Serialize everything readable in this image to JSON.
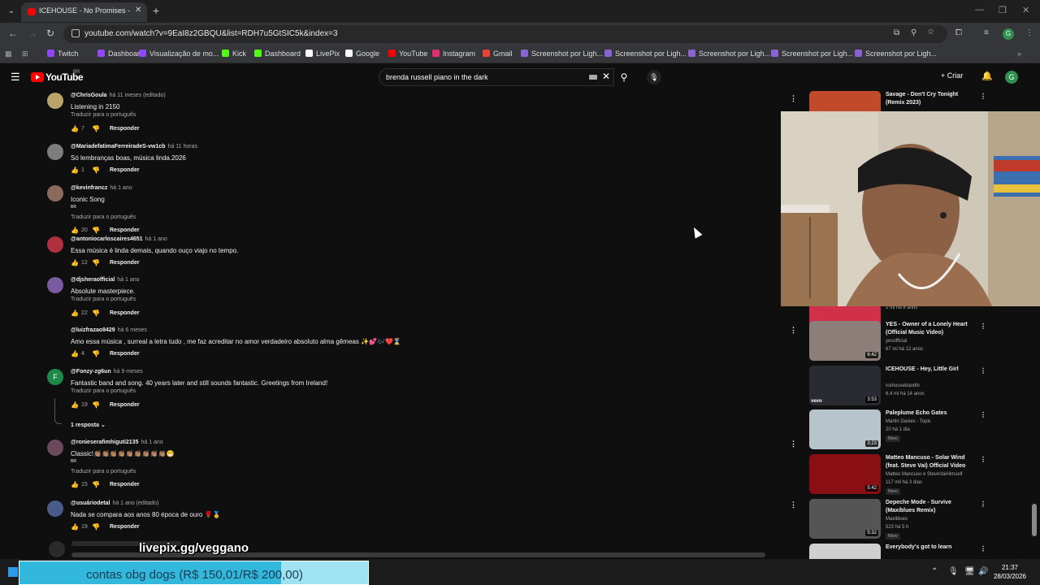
{
  "browser": {
    "tab_title": "ICEHOUSE - No Promises - Offi",
    "url": "youtube.com/watch?v=9EaI8z2GBQU&list=RDH7u5GtSIC5k&index=3",
    "bookmarks": [
      {
        "label": "Twitch",
        "color": "#9146ff"
      },
      {
        "label": "Dashboard",
        "color": "#9146ff"
      },
      {
        "label": "Visualização de mo...",
        "color": "#9146ff"
      },
      {
        "label": "Kick",
        "color": "#53fc18"
      },
      {
        "label": "Dashboard",
        "color": "#53fc18"
      },
      {
        "label": "LivePix",
        "color": "#ffffff"
      },
      {
        "label": "Google",
        "color": "#ffffff"
      },
      {
        "label": "YouTube",
        "color": "#ff0000"
      },
      {
        "label": "Instagram",
        "color": "#e1306c"
      },
      {
        "label": "Gmail",
        "color": "#ea4335"
      },
      {
        "label": "Screenshot por Ligh...",
        "color": "#8a63d2"
      },
      {
        "label": "Screenshot por Ligh...",
        "color": "#8a63d2"
      },
      {
        "label": "Screenshot por Ligh...",
        "color": "#8a63d2"
      },
      {
        "label": "Screenshot por Ligh...",
        "color": "#8a63d2"
      },
      {
        "label": "Screenshot por Ligh...",
        "color": "#8a63d2"
      }
    ],
    "profile_initial": "G"
  },
  "youtube": {
    "logo_text": "YouTube",
    "logo_region": "BR",
    "search_query": "brenda russell piano in the dark",
    "create_label": "Criar",
    "avatar_initial": "G"
  },
  "comments": [
    {
      "author": "@ChrisGoula",
      "time": "há 11 meses (editado)",
      "text": "Listening in 2150",
      "translate": "Traduzir para o português",
      "likes": "7",
      "reply": "Responder",
      "avatar_color": "#b9a46a"
    },
    {
      "author": "@MariadefatimaFerreiradeS-vw1cb",
      "time": "há 11 horas",
      "text": "Só lembranças boas, música linda.2026",
      "translate": "",
      "likes": "1",
      "reply": "Responder",
      "avatar_color": "#7d7d7d"
    },
    {
      "author": "@kevinfrancz",
      "time": "há 1 ano",
      "text": "Iconic Song",
      "flag": "BR",
      "translate": "Traduzir para o português",
      "likes": "20",
      "reply": "Responder",
      "avatar_color": "#8a6a5a"
    },
    {
      "author": "@antoniocarloscaires4651",
      "time": "há 1 ano",
      "text": "Essa música é linda demais, quando ouço viajo no tempo.",
      "translate": "",
      "likes": "12",
      "reply": "Responder",
      "avatar_color": "#b03040"
    },
    {
      "author": "@djsheraofficial",
      "time": "há 1 ano",
      "text": "Absolute masterpiece.",
      "translate": "Traduzir para o português",
      "likes": "22",
      "reply": "Responder",
      "avatar_color": "#7a5aa0"
    },
    {
      "author": "@luizfrazao9429",
      "time": "há 6 meses",
      "text": "Amo essa música , surreal a letra tudo , me faz acreditar no amor verdadeiro absoluto alma gêmeas ✨💕🎶❤️⌛",
      "translate": "",
      "likes": "4",
      "reply": "Responder",
      "avatar_color": "#0f0f0f"
    },
    {
      "author": "@Fonzy-zg6un",
      "time": "há 9 meses",
      "text": "Fantastic band and song. 40 years later and still sounds fantastic.  Greetings from Ireland!",
      "translate": "Traduzir para o português",
      "likes": "19",
      "reply": "Responder",
      "avatar_color": "#1e8a4a",
      "initial": "F"
    },
    {
      "author": "@ronieserafimhiguti2135",
      "time": "há 1 ano",
      "text": "Classic!👏🏽👏🏽👏🏽👏🏽👏🏽👏🏽👏🏽👏🏽👏🏽😁",
      "flag": "BR",
      "translate": "Traduzir para o português",
      "likes": "15",
      "reply": "Responder",
      "avatar_color": "#6a4a5a"
    },
    {
      "author": "@usuáriodetal",
      "time": "há 1 ano (editado)",
      "text": "Nada se compara aos anos 80 época de ouro 🌹🏅",
      "translate": "",
      "likes": "19",
      "reply": "Responder",
      "avatar_color": "#4a5a8a"
    }
  ],
  "replies_toggle": "1 resposta",
  "recommendations": [
    {
      "title": "Savage - Don't Cry Tonight (Remix 2023)",
      "channel": "",
      "meta": "",
      "duration": "",
      "thumb": "#c14a2a"
    },
    {
      "title": "",
      "channel": "",
      "meta": "2 mi  há 8 anos",
      "duration": "4:05",
      "thumb": "#d0304a"
    },
    {
      "title": "YES - Owner of a Lonely Heart (Official Music Video)",
      "channel": "yesofficial",
      "meta": "67 mi  há 12 anos",
      "duration": "6:42",
      "thumb": "#8c7f7a"
    },
    {
      "title": "ICEHOUSE - Hey, Little Girl",
      "channel": "icehousebandtv",
      "meta": "6,4 mi  há 14 anos",
      "duration": "3:53",
      "thumb": "#2a2a33",
      "brand": "vevo"
    },
    {
      "title": "Paleplume Echo Gates",
      "channel": "Martin Davies - Topic",
      "meta": "20  há 1 dia",
      "duration": "3:23",
      "thumb": "#b8c4cc",
      "badge": "Novo"
    },
    {
      "title": "Matteo Mancuso - Solar Wind (feat. Steve Vai) Official Video",
      "channel": "Matteo Mancuso e SteveVaiHimself",
      "meta": "117 mil  há 3 dias",
      "duration": "5:42",
      "thumb": "#8a0f14",
      "badge": "Novo"
    },
    {
      "title": "Depeche Mode - Survive (Maxiblues Remix)",
      "channel": "Maxiblues",
      "meta": "523  há 5 h",
      "duration": "5:32",
      "thumb": "#555555",
      "badge": "Novo"
    },
    {
      "title": "Everybody's got to learn",
      "channel": "",
      "meta": "",
      "duration": "",
      "thumb": "#cfcfcf"
    }
  ],
  "overlay": {
    "donation_url": "livepix.gg/veggano",
    "goal_text": "contas obg dogs (R$ 150,01/R$ 200,00)",
    "goal_progress": 0.75
  },
  "taskbar": {
    "time": "21:37",
    "date": "28/03/2026"
  }
}
